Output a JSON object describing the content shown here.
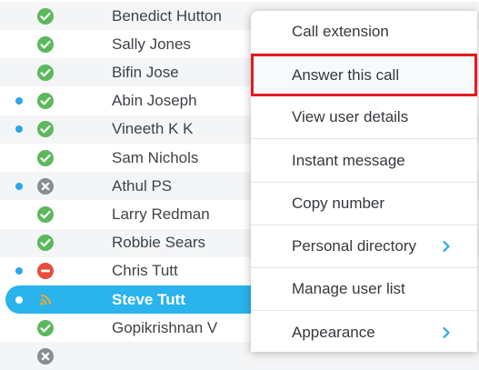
{
  "users": [
    {
      "name": "Benedict Hutton",
      "status": "available",
      "dot": false,
      "alt": true
    },
    {
      "name": "Sally Jones",
      "status": "available",
      "dot": false,
      "alt": false
    },
    {
      "name": "Bifin Jose",
      "status": "available",
      "dot": false,
      "alt": true
    },
    {
      "name": "Abin Joseph",
      "status": "available",
      "dot": true,
      "alt": false
    },
    {
      "name": "Vineeth K K",
      "status": "available",
      "dot": true,
      "alt": true
    },
    {
      "name": "Sam Nichols",
      "status": "available",
      "dot": false,
      "alt": false
    },
    {
      "name": "Athul PS",
      "status": "offline",
      "dot": true,
      "alt": true
    },
    {
      "name": "Larry Redman",
      "status": "available",
      "dot": false,
      "alt": false
    },
    {
      "name": "Robbie Sears",
      "status": "available",
      "dot": false,
      "alt": true
    },
    {
      "name": "Chris Tutt",
      "status": "busy",
      "dot": true,
      "alt": false
    },
    {
      "name": "Steve Tutt",
      "status": "ringing",
      "dot": true,
      "alt": false,
      "selected": true
    },
    {
      "name": "Gopikrishnan V",
      "status": "available",
      "dot": false,
      "alt": false
    },
    {
      "name": "",
      "status": "offline",
      "dot": false,
      "alt": true
    }
  ],
  "context_menu": {
    "items": [
      {
        "label": "Call extension",
        "submenu": false,
        "highlighted": false
      },
      {
        "label": "Answer this call",
        "submenu": false,
        "highlighted": true
      },
      {
        "label": "View user details",
        "submenu": false,
        "highlighted": false
      },
      {
        "label": "Instant message",
        "submenu": false,
        "highlighted": false
      },
      {
        "label": "Copy number",
        "submenu": false,
        "highlighted": false
      },
      {
        "label": "Personal directory",
        "submenu": true,
        "highlighted": false
      },
      {
        "label": "Manage user list",
        "submenu": false,
        "highlighted": false
      },
      {
        "label": "Appearance",
        "submenu": true,
        "highlighted": false
      }
    ]
  },
  "icons": {
    "available": "check-circle-icon",
    "offline": "x-circle-icon",
    "busy": "minus-circle-icon",
    "ringing": "ringing-waves-icon",
    "submenu": "chevron-right-icon"
  },
  "colors": {
    "available": "#5cb85c",
    "offline": "#8a8d90",
    "busy": "#e84c3d",
    "ringing": "#f0a92e",
    "presence_dot": "#29a8e8",
    "selection": "#2ab3ec",
    "chevron": "#29a8e8",
    "highlight_outline": "#e11b22"
  }
}
